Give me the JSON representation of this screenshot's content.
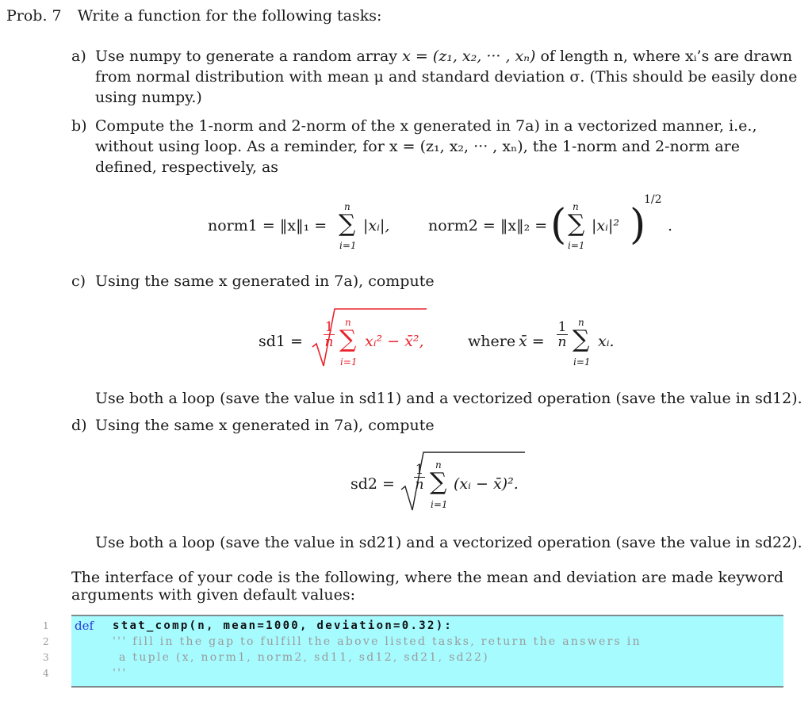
{
  "problem": {
    "label": "Prob. 7",
    "intro": "Write a function for the following tasks:"
  },
  "parts": {
    "a": {
      "marker": "a)",
      "line1_pre": "Use numpy to generate a random array",
      "line1_math": "x = (z₁, x₂, ··· , xₙ)",
      "line1_post": "of length n, where xᵢ’s are drawn",
      "line2": "from normal distribution with mean μ and standard deviation σ. (This should be easily done",
      "line3": "using numpy.)"
    },
    "b": {
      "marker": "b)",
      "line1": "Compute the 1-norm and 2-norm of the x generated in 7a) in a vectorized manner, i.e.,",
      "line2": "without using loop. As a reminder, for x = (z₁, x₂, ··· , xₙ), the 1-norm and 2-norm are",
      "line3": "defined, respectively, as",
      "eq_norm1_lhs": "norm1 = ‖x‖₁ =",
      "eq_norm1_rhs": "|xᵢ|,",
      "eq_norm2_lhs": "norm2 = ‖x‖₂ =",
      "eq_norm2_body": "|xᵢ|²",
      "eq_norm2_exp": "1/2",
      "sum_upper": "n",
      "sum_lower": "i=1"
    },
    "c": {
      "marker": "c)",
      "line1": "Using the same x generated in 7a), compute",
      "eq_lhs": "sd1 =",
      "eq_body": "xᵢ² − x̄²,",
      "eq_where": "where",
      "eq_xbar": "x̄ =",
      "eq_xbar_body": "xᵢ.",
      "frac_num": "1",
      "frac_den": "n",
      "note": "Use both a loop (save the value in sd11) and a vectorized operation (save the value in sd12)."
    },
    "d": {
      "marker": "d)",
      "line1": "Using the same x generated in 7a), compute",
      "eq_lhs": "sd2 =",
      "eq_body": "(xᵢ − x̄)².",
      "note": "Use both a loop (save the value in sd21) and a vectorized operation (save the value in sd22)."
    }
  },
  "interface": {
    "line1": "The interface of your code is the following, where the mean and deviation are made keyword",
    "line2": "arguments with given default values:"
  },
  "code": {
    "colors": {
      "background": "#a6fbff",
      "keyword": "#2b3ad8",
      "comment": "#9a9a9a",
      "highlight": "#e8232d"
    },
    "lines": [
      {
        "no": "1",
        "kw": "def",
        "text": "stat_comp(n,  mean=1000,  deviation=0.32):"
      },
      {
        "no": "2",
        "kw": "",
        "text": "''' fill in the gap to fulfill the above listed tasks,  return the answers in"
      },
      {
        "no": "3",
        "kw": "",
        "text": "  a tuple  (x, norm1, norm2,  sd11, sd12, sd21, sd22)"
      },
      {
        "no": "4",
        "kw": "",
        "text": "'''"
      }
    ]
  }
}
